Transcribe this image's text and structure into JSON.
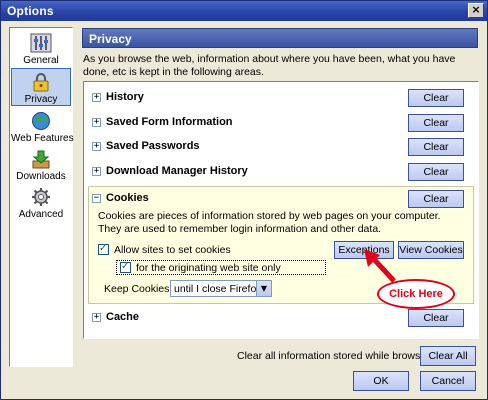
{
  "window": {
    "title": "Options",
    "close_glyph": "×"
  },
  "sidebar": {
    "items": [
      {
        "label": "General",
        "icon": "sliders-icon"
      },
      {
        "label": "Privacy",
        "icon": "lock-icon",
        "selected": true
      },
      {
        "label": "Web Features",
        "icon": "globe-icon"
      },
      {
        "label": "Downloads",
        "icon": "download-icon"
      },
      {
        "label": "Advanced",
        "icon": "gear-icon"
      }
    ]
  },
  "header": {
    "title": "Privacy"
  },
  "intro": "As you browse the web, information about where you have been, what you have done, etc is kept in the following areas.",
  "sections": {
    "history": {
      "label": "History",
      "toggle": "+",
      "button": "Clear"
    },
    "forms": {
      "label": "Saved Form Information",
      "toggle": "+",
      "button": "Clear"
    },
    "passwords": {
      "label": "Saved Passwords",
      "toggle": "+",
      "button": "Clear"
    },
    "downloads": {
      "label": "Download Manager History",
      "toggle": "+",
      "button": "Clear"
    },
    "cookies": {
      "label": "Cookies",
      "toggle": "−",
      "button": "Clear",
      "description": "Cookies are pieces of information stored by web pages on your computer. They are used to remember login information and other data.",
      "allow_label": "Allow sites to set cookies",
      "origin_label": "for the originating web site only",
      "exceptions_button": "Exceptions",
      "view_button": "View Cookies",
      "keep_label": "Keep Cookies:",
      "keep_value": "until I close Firefox",
      "check_glyph": "✓",
      "dropdown_glyph": "▼"
    },
    "cache": {
      "label": "Cache",
      "toggle": "+",
      "button": "Clear"
    }
  },
  "annotation": {
    "callout": "Click Here",
    "color": "#e0001a"
  },
  "footer": {
    "clear_all_label": "Clear all information stored while browsing:",
    "clear_all_button": "Clear All",
    "ok_button": "OK",
    "cancel_button": "Cancel"
  }
}
